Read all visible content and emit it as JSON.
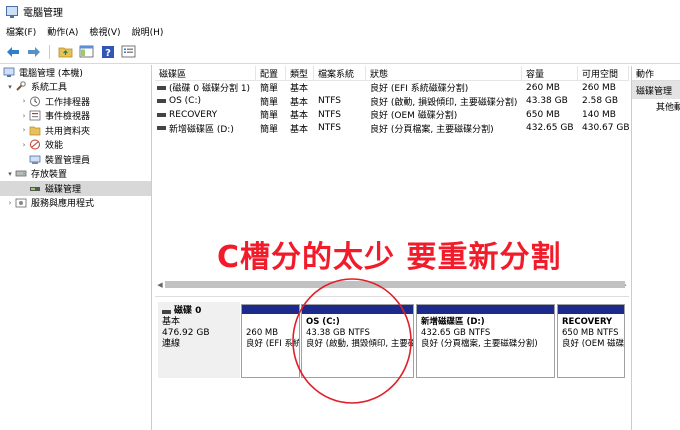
{
  "window": {
    "title": "電腦管理"
  },
  "menu": [
    "檔案(F)",
    "動作(A)",
    "檢視(V)",
    "說明(H)"
  ],
  "tree": [
    {
      "label": "電腦管理 (本機)",
      "depth": 0,
      "twisty": "",
      "icon": "computer-icon"
    },
    {
      "label": "系統工具",
      "depth": 1,
      "twisty": "▾",
      "icon": "tools-icon"
    },
    {
      "label": "工作排程器",
      "depth": 2,
      "twisty": "›",
      "icon": "clock-icon"
    },
    {
      "label": "事件檢視器",
      "depth": 2,
      "twisty": "›",
      "icon": "event-viewer-icon"
    },
    {
      "label": "共用資料夾",
      "depth": 2,
      "twisty": "›",
      "icon": "shared-folder-icon"
    },
    {
      "label": "效能",
      "depth": 2,
      "twisty": "›",
      "icon": "performance-icon"
    },
    {
      "label": "裝置管理員",
      "depth": 2,
      "twisty": "",
      "icon": "device-manager-icon"
    },
    {
      "label": "存放裝置",
      "depth": 1,
      "twisty": "▾",
      "icon": "storage-icon"
    },
    {
      "label": "磁碟管理",
      "depth": 2,
      "twisty": "",
      "icon": "disk-management-icon",
      "selected": true
    },
    {
      "label": "服務與應用程式",
      "depth": 1,
      "twisty": "›",
      "icon": "services-icon"
    }
  ],
  "volumes": {
    "headers": [
      "磁碟區",
      "配置",
      "類型",
      "檔案系統",
      "狀態",
      "容量",
      "可用空間"
    ],
    "rows": [
      [
        "(磁碟 0 磁碟分割 1)",
        "簡單",
        "基本",
        "",
        "良好 (EFI 系統磁碟分割)",
        "260 MB",
        "260 MB"
      ],
      [
        "OS (C:)",
        "簡單",
        "基本",
        "NTFS",
        "良好 (啟動, 損毀傾印, 主要磁碟分割)",
        "43.38 GB",
        "2.58 GB"
      ],
      [
        "RECOVERY",
        "簡單",
        "基本",
        "NTFS",
        "良好 (OEM 磁碟分割)",
        "650 MB",
        "140 MB"
      ],
      [
        "新增磁碟區 (D:)",
        "簡單",
        "基本",
        "NTFS",
        "良好 (分頁檔案, 主要磁碟分割)",
        "432.65 GB",
        "430.67 GB"
      ]
    ]
  },
  "disk": {
    "name": "磁碟 0",
    "type": "基本",
    "size": "476.92 GB",
    "status": "連線"
  },
  "partitions": [
    {
      "name": "",
      "size": "260 MB",
      "status": "良好 (EFI 系統磁碟分割)"
    },
    {
      "name": "OS  (C:)",
      "size": "43.38 GB NTFS",
      "status": "良好 (啟動, 損毀傾印, 主要磁碟分割)"
    },
    {
      "name": "新增磁碟區  (D:)",
      "size": "432.65 GB NTFS",
      "status": "良好 (分頁檔案, 主要磁碟分割)"
    },
    {
      "name": "RECOVERY",
      "size": "650 MB NTFS",
      "status": "良好 (OEM 磁碟分割)"
    }
  ],
  "actions": {
    "header": "動作",
    "section": "磁碟管理",
    "more": "其他動作"
  },
  "annotation": {
    "text": "C槽分的太少  要重新分割",
    "color": "#f21b2a"
  },
  "colors": {
    "partition_bar": "#1c2a8c",
    "selected": "#d8d8d8"
  }
}
